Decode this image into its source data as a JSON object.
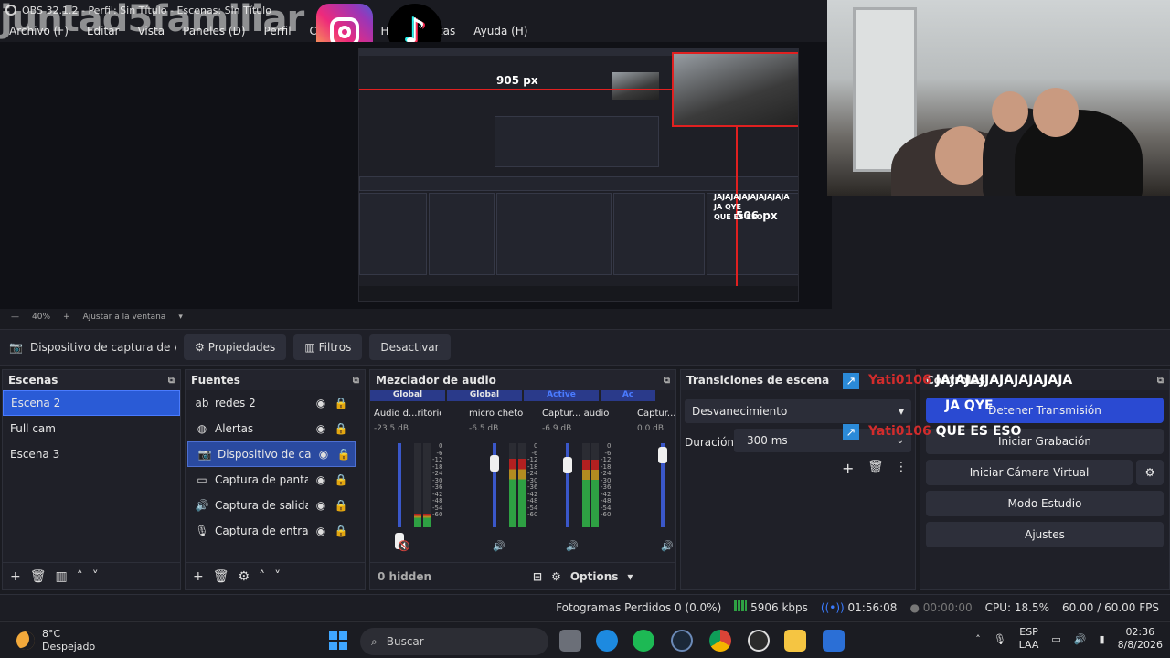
{
  "window": {
    "title": "OBS 32.1.2 - Perfil: Sin Título - Escenas: Sin Título",
    "watermark": "juntad5familiar"
  },
  "menu": [
    "Archivo (F)",
    "Editar",
    "Vista",
    "Paneles (D)",
    "Perfil",
    "Colección",
    "Herramientas",
    "Ayuda (H)"
  ],
  "preview": {
    "width_label": "905 px",
    "height_label": "506 px",
    "nested_chat": [
      "JAJAJAJAJAJAJAJAJA",
      "JA QYE",
      "QUE ES ESO"
    ]
  },
  "zoom_row": {
    "zoom": "40%",
    "fit": "Ajustar a la ventana"
  },
  "source_toolbar": {
    "source_name": "Dispositivo de captura de v",
    "properties": "Propiedades",
    "filters": "Filtros",
    "deactivate": "Desactivar"
  },
  "scenes": {
    "title": "Escenas",
    "items": [
      "Escena 2",
      "Full cam",
      "Escena 3"
    ],
    "selected": 0
  },
  "sources": {
    "title": "Fuentes",
    "items": [
      {
        "label": "redes 2",
        "icon": "text-icon"
      },
      {
        "label": "Alertas",
        "icon": "browser-icon"
      },
      {
        "label": "Dispositivo de captura de video",
        "icon": "camera-icon"
      },
      {
        "label": "Captura de pantalla",
        "icon": "monitor-icon"
      },
      {
        "label": "Captura de salida de audio",
        "icon": "speaker-icon"
      },
      {
        "label": "Captura de entrada de audio",
        "icon": "mic-icon"
      }
    ],
    "selected": 2
  },
  "mixer": {
    "title": "Mezclador de audio",
    "tabs": [
      "Global",
      "Global",
      "Active",
      "Ac"
    ],
    "channels": [
      {
        "name": "Audio d...ritorio",
        "db": "-23.5 dB",
        "level": 0.16,
        "muted": true
      },
      {
        "name": "micro cheto",
        "db": "-6.5 dB",
        "level": 0.82,
        "muted": false
      },
      {
        "name": "Captur... audio",
        "db": "-6.9 dB",
        "level": 0.8,
        "muted": false
      },
      {
        "name": "Captur...",
        "db": "0.0 dB",
        "level": 0.0,
        "muted": false
      }
    ],
    "scale": [
      "0",
      "-6",
      "-12",
      "-18",
      "-24",
      "-30",
      "-36",
      "-42",
      "-48",
      "-54",
      "-60"
    ],
    "hidden": "0 hidden",
    "options": "Options"
  },
  "transitions": {
    "title": "Transiciones de escena",
    "selected": "Desvanecimiento",
    "duration_label": "Duración",
    "duration_value": "300 ms"
  },
  "controls": {
    "title": "Controles",
    "stop_stream": "Detener Transmisión",
    "start_recording": "Iniciar Grabación",
    "virtual_cam": "Iniciar Cámara Virtual",
    "studio_mode": "Modo Estudio",
    "settings": "Ajustes"
  },
  "chat": [
    {
      "user": "Yati0106",
      "message": "JAJAJAJJAJAJAJAJAJA"
    },
    {
      "user": "",
      "message": "JA QYE"
    },
    {
      "user": "Yati0106",
      "message": "QUE ES ESO"
    }
  ],
  "status": {
    "dropped_frames": "Fotogramas Perdidos 0 (0.0%)",
    "bitrate": "5906 kbps",
    "stream_time": "01:56:08",
    "rec_time": "00:00:00",
    "cpu": "CPU: 18.5%",
    "fps": "60.00 / 60.00 FPS"
  },
  "taskbar": {
    "temperature": "8°C",
    "weather": "Despejado",
    "search": "Buscar",
    "lang_top": "ESP",
    "lang_bottom": "LAA",
    "time": "02:36",
    "date": "8/8/2026"
  },
  "colors": {
    "accent_blue": "#2a5bd6",
    "stream_button": "#2a4ad2",
    "meter_green": "#2ea043",
    "meter_red": "#b32020",
    "chat_user_red": "#d22c2c"
  }
}
